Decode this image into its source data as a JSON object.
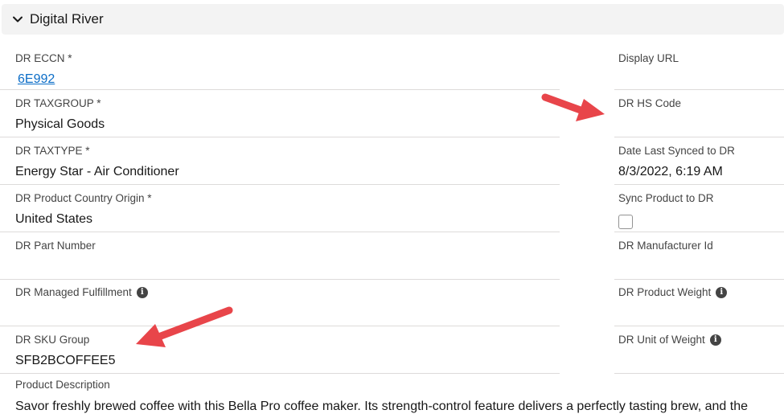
{
  "section": {
    "title": "Digital River",
    "icon": "chevron-down-icon"
  },
  "left_fields": [
    {
      "label": "DR ECCN *",
      "value": "6E992"
    },
    {
      "label": "DR TAXGROUP *",
      "value": "Physical Goods"
    },
    {
      "label": "DR TAXTYPE *",
      "value": "Energy Star - Air Conditioner"
    },
    {
      "label": "DR Product Country Origin *",
      "value": "United States"
    },
    {
      "label": "DR Part Number",
      "value": ""
    },
    {
      "label": "DR Managed Fulfillment",
      "value": ""
    },
    {
      "label": "DR SKU Group",
      "value": "SFB2BCOFFEE5"
    }
  ],
  "right_fields": [
    {
      "label": "Display URL",
      "value": ""
    },
    {
      "label": "DR HS Code",
      "value": ""
    },
    {
      "label": "Date Last Synced to DR",
      "value": "8/3/2022, 6:19 AM"
    },
    {
      "label": "Sync Product to DR",
      "value": ""
    },
    {
      "label": "DR Manufacturer Id",
      "value": ""
    },
    {
      "label": "DR Product Weight",
      "value": ""
    },
    {
      "label": "DR Unit of Weight",
      "value": ""
    }
  ],
  "product_description": {
    "label": "Product Description",
    "text": "Savor freshly brewed coffee with this Bella Pro coffee maker. Its strength-control feature delivers a perfectly tasting brew, and the"
  },
  "info_icon_glyph": "i",
  "colors": {
    "arrow": "#e8454a",
    "link": "#0b6dc7",
    "header_bg": "#f3f3f3"
  }
}
